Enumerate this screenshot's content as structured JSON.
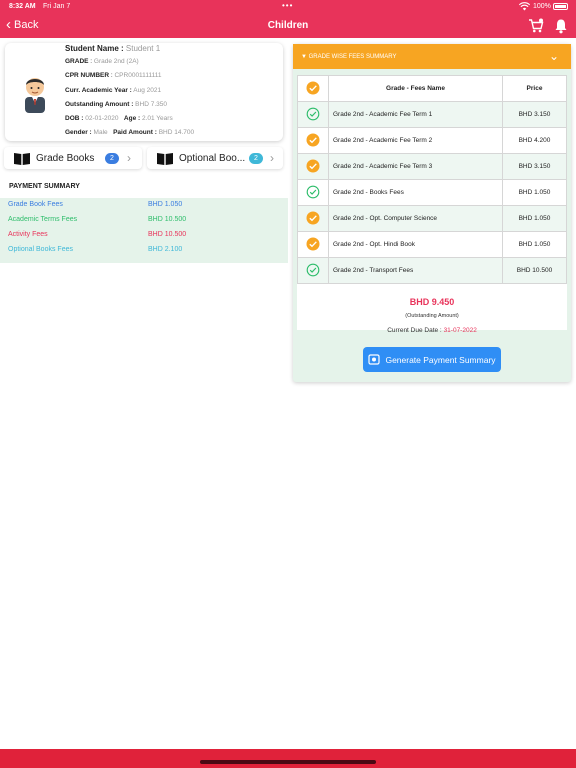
{
  "status_bar": {
    "time": "8:32 AM",
    "date": "Fri Jan 7",
    "battery": "100%"
  },
  "nav": {
    "back_label": "Back",
    "title": "Children",
    "cart_icon": "cart-icon",
    "bell_icon": "bell-icon"
  },
  "student": {
    "name_label": "Student Name :",
    "name": "Student 1",
    "grade_label": "GRADE",
    "grade": "Grade 2nd (2A)",
    "cpr_label": "CPR NUMBER",
    "cpr": "CPR0001111111",
    "year_label": "Curr. Academic Year :",
    "year": "Aug 2021",
    "outstanding_label": "Outstanding Amount :",
    "outstanding": "BHD 7.350",
    "dob_label": "DOB :",
    "dob": "02-01-2020",
    "age_label": "Age :",
    "age": "2.01 Years",
    "gender_label": "Gender :",
    "gender": "Male",
    "paid_label": "Paid Amount :",
    "paid": "BHD 14.700"
  },
  "books": {
    "grade_books": {
      "label": "Grade Books",
      "count": "2",
      "badge_color": "#3a7de0"
    },
    "optional_books": {
      "label": "Optional Boo...",
      "count": "2",
      "badge_color": "#3fb8d8"
    }
  },
  "payment_summary": {
    "title": "PAYMENT SUMMARY",
    "rows": [
      {
        "label": "Grade Book Fees",
        "amount": "BHD 1.050",
        "color": "#3a7de0"
      },
      {
        "label": "Academic Terms Fees",
        "amount": "BHD 10.500",
        "color": "#2ebd6b"
      },
      {
        "label": "Activity Fees",
        "amount": "BHD 10.500",
        "color": "#e8335a"
      },
      {
        "label": "Optional Books Fees",
        "amount": "BHD 2.100",
        "color": "#3fb8d8"
      }
    ]
  },
  "fee_panel": {
    "header": "▼ GRADE WISE FEES SUMMARY",
    "col_name": "Grade - Fees Name",
    "col_price": "Price",
    "rows": [
      {
        "name": "Grade 2nd - Academic Fee Term 1",
        "price": "BHD 3.150",
        "status": "paid"
      },
      {
        "name": "Grade 2nd - Academic Fee Term 2",
        "price": "BHD 4.200",
        "status": "selected"
      },
      {
        "name": "Grade 2nd - Academic Fee Term 3",
        "price": "BHD 3.150",
        "status": "selected"
      },
      {
        "name": "Grade 2nd - Books Fees",
        "price": "BHD 1.050",
        "status": "paid"
      },
      {
        "name": "Grade 2nd - Opt. Computer Science",
        "price": "BHD 1.050",
        "status": "selected"
      },
      {
        "name": "Grade 2nd - Opt. Hindi Book",
        "price": "BHD 1.050",
        "status": "selected"
      },
      {
        "name": "Grade 2nd - Transport Fees",
        "price": "BHD 10.500",
        "status": "paid"
      }
    ],
    "total": "BHD 9.450",
    "total_label": "(Outstanding Amount)",
    "due_label": "Current Due Date :",
    "due_date": "31-07-2022",
    "generate_label": "Generate Payment Summary"
  },
  "colors": {
    "accent": "#e8335a",
    "orange": "#f7a522",
    "green": "#2ebd6b",
    "blue": "#2f8ef5"
  }
}
